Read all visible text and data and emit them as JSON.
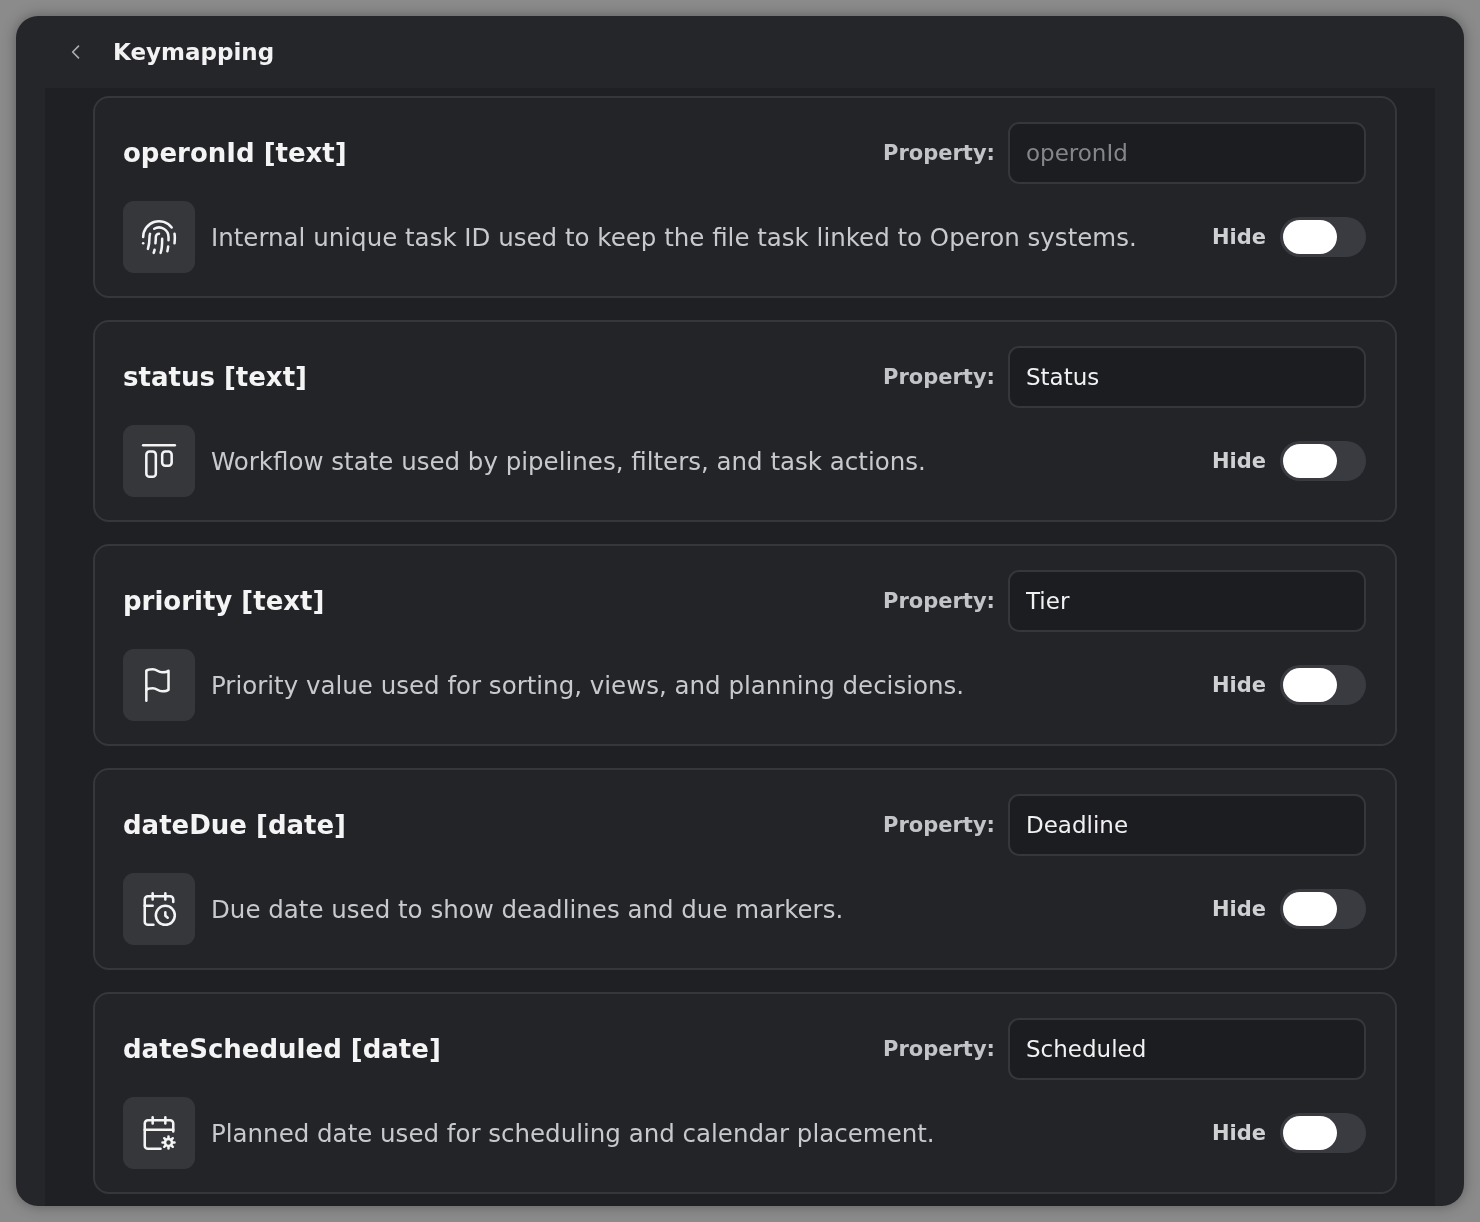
{
  "window": {
    "title": "Keymapping"
  },
  "fields": [
    {
      "title": "operonId [text]",
      "property_label": "Property:",
      "property": {
        "placeholder": "operonId"
      },
      "description": "Internal unique task ID used to keep the file task linked to Operon systems.",
      "hide_label": "Hide",
      "hidden": false
    },
    {
      "title": "status [text]",
      "property_label": "Property:",
      "property": {
        "value": "Status"
      },
      "description": "Workflow state used by pipelines, filters, and task actions.",
      "hide_label": "Hide",
      "hidden": false
    },
    {
      "title": "priority [text]",
      "property_label": "Property:",
      "property": {
        "value": "Tier"
      },
      "description": "Priority value used for sorting, views, and planning decisions.",
      "hide_label": "Hide",
      "hidden": false
    },
    {
      "title": "dateDue [date]",
      "property_label": "Property:",
      "property": {
        "value": "Deadline"
      },
      "description": "Due date used to show deadlines and due markers.",
      "hide_label": "Hide",
      "hidden": false
    },
    {
      "title": "dateScheduled [date]",
      "property_label": "Property:",
      "property": {
        "value": "Scheduled"
      },
      "description": "Planned date used for scheduling and calendar placement.",
      "hide_label": "Hide",
      "hidden": false
    }
  ]
}
